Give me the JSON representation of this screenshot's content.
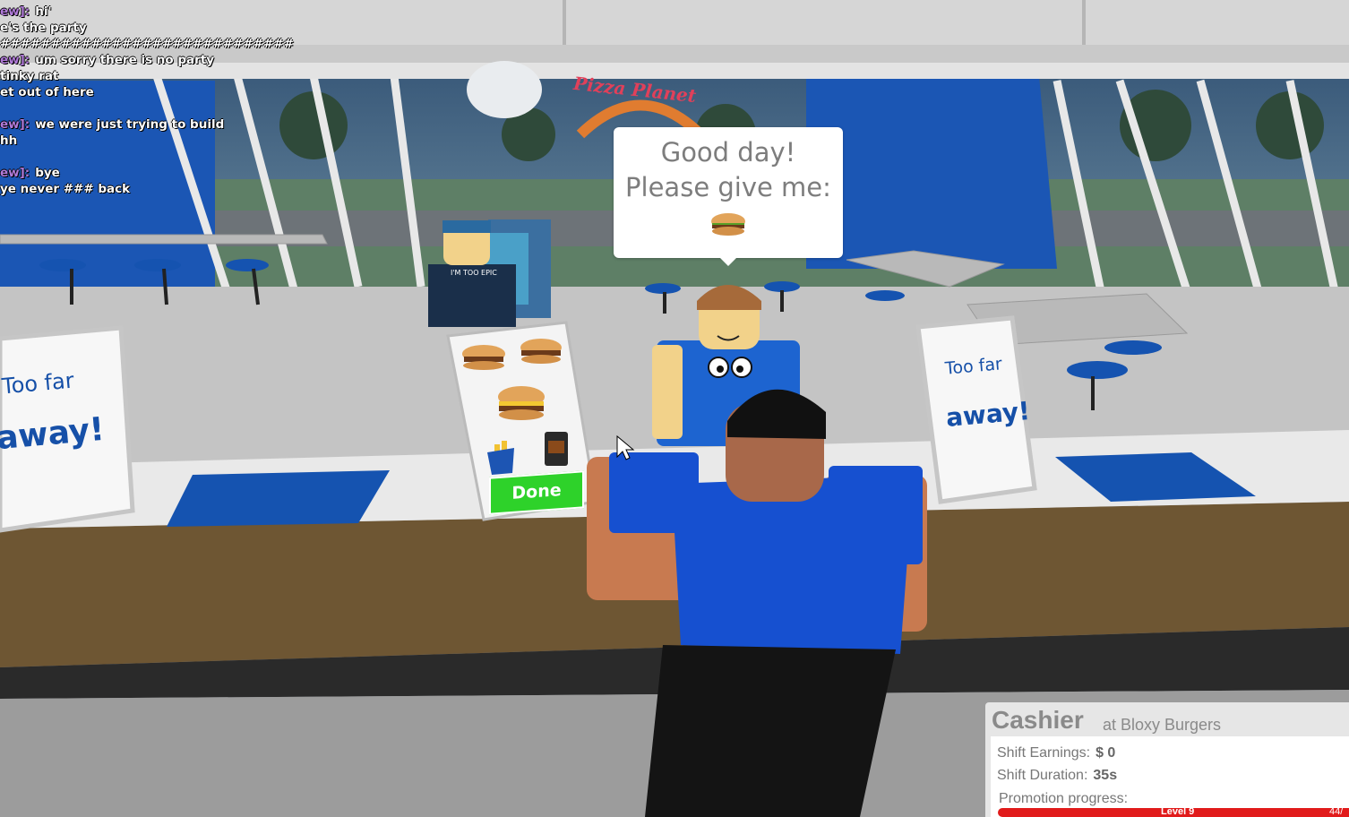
{
  "chat": [
    {
      "name": "ew]:",
      "text": "hi'"
    },
    {
      "name": "",
      "text": "e's the party"
    },
    {
      "name": "",
      "text": "#############################"
    },
    {
      "name": "ew]:",
      "text": "um sorry there is no party"
    },
    {
      "name": "",
      "text": "tinky rat"
    },
    {
      "name": "",
      "text": "et out of here"
    },
    {
      "name": "",
      "text": ""
    },
    {
      "name": "ew]:",
      "text": "we were just trying to build"
    },
    {
      "name": "",
      "text": "hh"
    },
    {
      "name": "",
      "text": ""
    },
    {
      "name": "ew]:",
      "text": "bye"
    },
    {
      "name": "",
      "text": "ye never ### back"
    }
  ],
  "restaurant_sign": "Pizza Planet",
  "shirt_text": "I'M TOO EPIC",
  "speech_bubble": {
    "line1": "Good day!",
    "line2": "Please give me:",
    "order_icon": "burger-icon"
  },
  "signs": {
    "left_line1": "Too far",
    "left_line2": "away!",
    "right_line1": "Too far",
    "right_line2": "away!"
  },
  "menu": {
    "items": [
      "burger-icon",
      "burger-icon",
      "cheeseburger-icon",
      "fries-icon",
      "soda-icon"
    ],
    "done_label": "Done"
  },
  "job": {
    "title": "Cashier",
    "location": "at Bloxy Burgers",
    "earnings_label": "Shift Earnings:",
    "earnings_value": "$ 0",
    "duration_label": "Shift Duration:",
    "duration_value": "35s",
    "promotion_label": "Promotion progress:",
    "level_label": "Level 9",
    "count_label": "44/"
  },
  "colors": {
    "wall_blue": "#1b56b4",
    "tray_blue": "#1553b0",
    "counter_wood": "#6e5633",
    "done_green": "#2ed22a",
    "progress_red": "#e11b1b"
  }
}
